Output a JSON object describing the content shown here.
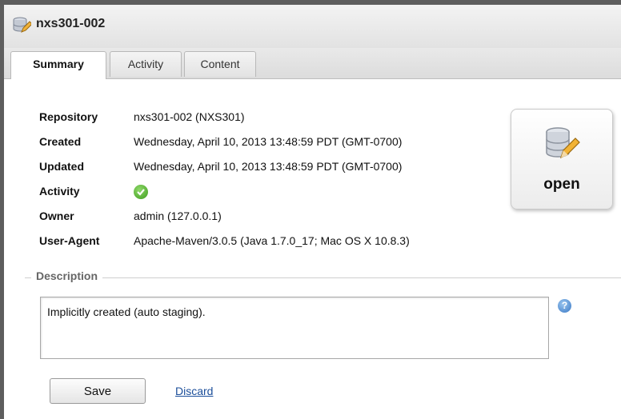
{
  "window": {
    "title": "nxs301-002",
    "title_icon": "database-edit-icon"
  },
  "tabs": [
    {
      "label": "Summary",
      "active": true
    },
    {
      "label": "Activity",
      "active": false
    },
    {
      "label": "Content",
      "active": false
    }
  ],
  "summary": {
    "properties": [
      {
        "label": "Repository",
        "value": "nxs301-002 (NXS301)"
      },
      {
        "label": "Created",
        "value": "Wednesday, April 10, 2013 13:48:59 PDT (GMT-0700)"
      },
      {
        "label": "Updated",
        "value": "Wednesday, April 10, 2013 13:48:59 PDT (GMT-0700)"
      },
      {
        "label": "Activity",
        "value": "",
        "icon": "check-icon"
      },
      {
        "label": "Owner",
        "value": "admin (127.0.0.1)"
      },
      {
        "label": "User-Agent",
        "value": "Apache-Maven/3.0.5 (Java 1.7.0_17; Mac OS X 10.8.3)"
      }
    ],
    "status_button": {
      "label": "open",
      "icon": "database-edit-icon"
    }
  },
  "description": {
    "legend": "Description",
    "value": "Implicitly created (auto staging).",
    "help_icon": "help-icon",
    "help_glyph": "?"
  },
  "actions": {
    "save_label": "Save",
    "discard_label": "Discard"
  },
  "colors": {
    "link": "#1b4e9a",
    "status_ok": "#3f9e1e",
    "help": "#3877c4"
  }
}
